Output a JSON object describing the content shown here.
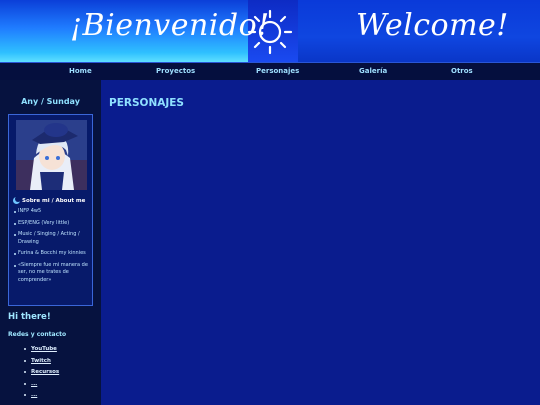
{
  "banner": {
    "title_es": "¡Bienvenido!",
    "title_en": "Welcome!",
    "icon": "sun-icon"
  },
  "nav": {
    "items": [
      {
        "label": "Home"
      },
      {
        "label": "Proyectos"
      },
      {
        "label": "Personajes"
      },
      {
        "label": "Galería"
      },
      {
        "label": "Otros"
      }
    ]
  },
  "sidebar": {
    "title": "Any / Sunday",
    "about_heading": "Sobre mi / About me",
    "about_items": [
      "INFP 4w5",
      "ESP/ENG (Very little)",
      "Music / Singing / Acting / Drawing",
      "Furina & Bocchi my kinnies",
      "«Siempre fue mi manera de ser, no me trates de comprender»"
    ],
    "greeting": "Hi there!",
    "social_heading": "Redes y contacto",
    "links": [
      "YouTube",
      "Twitch",
      "Recursos",
      "...",
      "..."
    ]
  },
  "main": {
    "heading": "PERSONAJES"
  },
  "colors": {
    "banner_blue": "#1460ff",
    "nav_bg": "#050f3e",
    "sidebar_bg": "#06123f",
    "main_bg": "#0a1c8e",
    "accent_text": "#8fe0ff"
  }
}
